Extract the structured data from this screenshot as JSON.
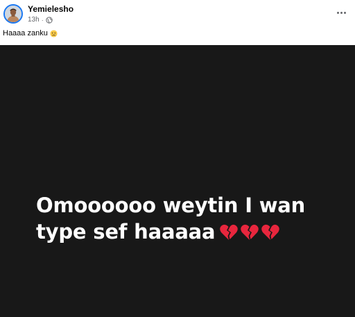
{
  "post": {
    "author": "Yemielesho",
    "time": "13h",
    "separator": "·",
    "privacy_icon": "globe-icon",
    "caption": "Haaaa zanku",
    "caption_emoji": "sad-face-icon"
  },
  "card": {
    "line1": "Omoooooo weytin I wan",
    "line2": "type sef haaaaa",
    "emoji": [
      "broken-heart-icon",
      "broken-heart-icon",
      "broken-heart-icon"
    ],
    "background": "#181818",
    "text_color": "#ffffff"
  },
  "colors": {
    "accent": "#1877f2",
    "secondary_text": "#65676b",
    "heart": "#e8263d"
  }
}
